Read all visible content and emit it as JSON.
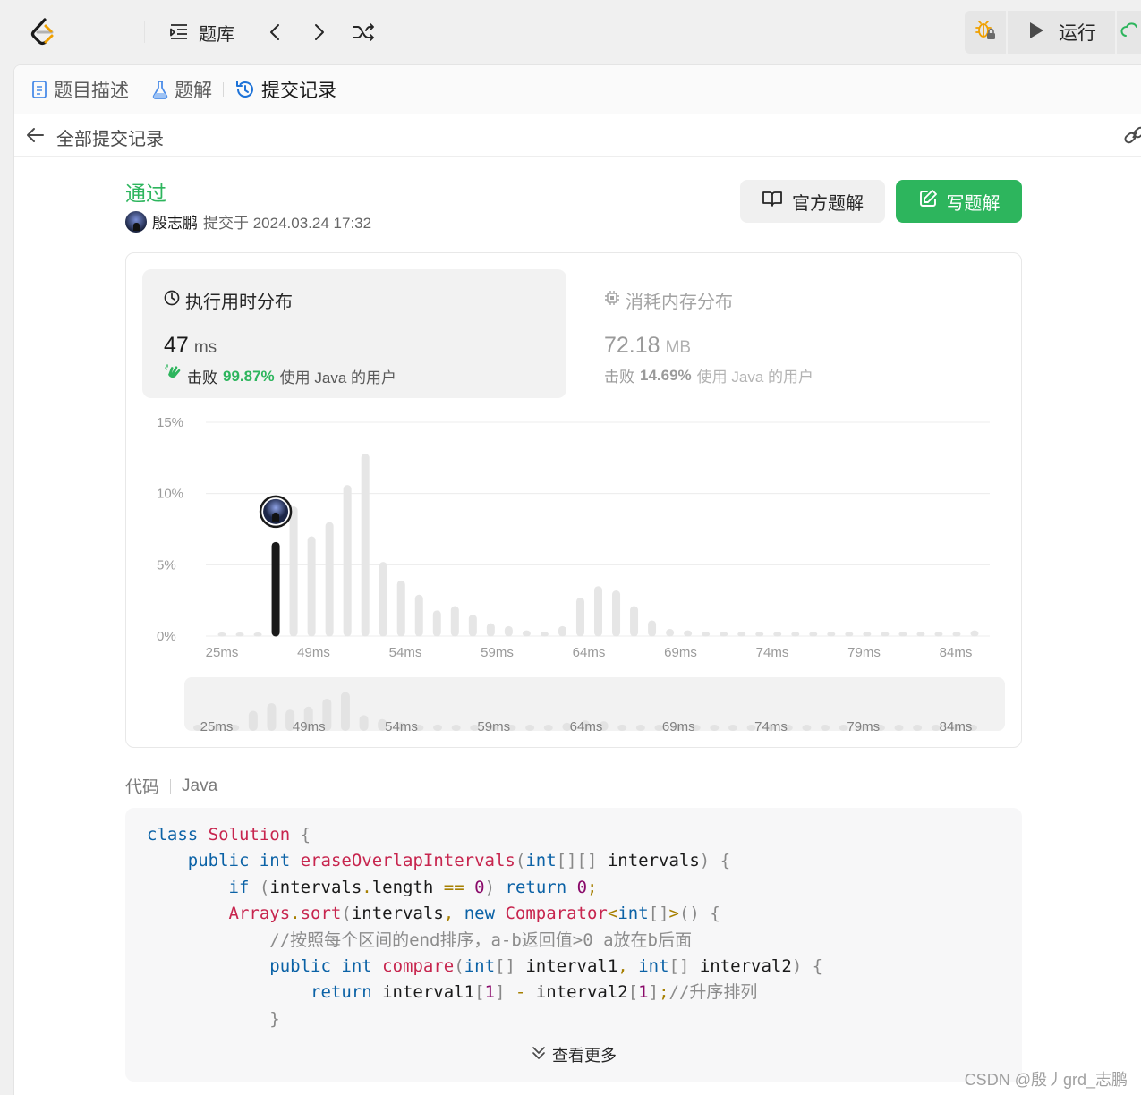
{
  "toolbar": {
    "problems_label": "题库",
    "run_label": "运行"
  },
  "tabs": [
    {
      "label": "题目描述",
      "icon": "document-icon"
    },
    {
      "label": "题解",
      "icon": "flask-icon"
    },
    {
      "label": "提交记录",
      "icon": "history-icon"
    }
  ],
  "subheader": {
    "back_label": "全部提交记录"
  },
  "submission": {
    "status": "通过",
    "user": "殷志鹏",
    "submitted_text": "提交于 2024.03.24 17:32",
    "official_button": "官方题解",
    "write_button": "写题解"
  },
  "runtime": {
    "title": "执行用时分布",
    "value": "47",
    "unit": "ms",
    "beat_prefix": "击败",
    "beat_pct": "99.87%",
    "beat_suffix": "使用 Java 的用户"
  },
  "memory": {
    "title": "消耗内存分布",
    "value": "72.18",
    "unit": "MB",
    "beat_prefix": "击败",
    "beat_pct": "14.69%",
    "beat_suffix": "使用 Java 的用户"
  },
  "chart_data": {
    "type": "bar",
    "title": "",
    "xlabel": "",
    "ylabel": "",
    "y_ticks": [
      "15%",
      "10%",
      "5%",
      "0%"
    ],
    "ylim": [
      0,
      15
    ],
    "x_tick_labels": [
      "25ms",
      "49ms",
      "54ms",
      "59ms",
      "64ms",
      "69ms",
      "74ms",
      "79ms",
      "84ms"
    ],
    "highlight_index": 3,
    "values": [
      0.2,
      0.2,
      0.2,
      6.6,
      9.1,
      7.0,
      8.0,
      10.6,
      12.8,
      5.2,
      3.9,
      2.9,
      1.8,
      2.1,
      1.5,
      0.9,
      0.7,
      0.4,
      0.3,
      0.7,
      2.7,
      3.5,
      3.2,
      2.1,
      1.1,
      0.5,
      0.4,
      0.3,
      0.3,
      0.3,
      0.3,
      0.3,
      0.3,
      0.3,
      0.3,
      0.3,
      0.3,
      0.3,
      0.3,
      0.3,
      0.3,
      0.3,
      0.4
    ],
    "grid": true
  },
  "code": {
    "label": "代码",
    "language": "Java",
    "view_more": "查看更多"
  },
  "watermark": "CSDN @殷丿grd_志鹏",
  "colors": {
    "accent_green": "#2db55d",
    "bar_highlight": "#1a1a1a",
    "bar_default": "#e6e6e6"
  }
}
